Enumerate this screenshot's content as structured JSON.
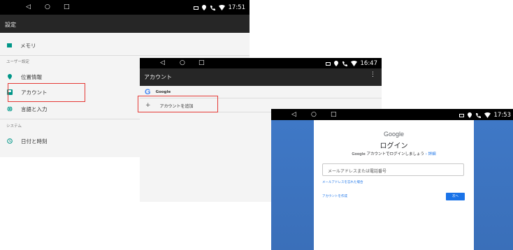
{
  "screen1": {
    "nav": {
      "back": "◁",
      "home": "○",
      "recent": "□"
    },
    "status": {
      "time": "17:51"
    },
    "title": "設定",
    "memory_label": "メモリ",
    "section_user": "ユーザー設定",
    "items": [
      {
        "label": "位置情報",
        "icon": "location-pin-icon"
      },
      {
        "label": "アカウント",
        "icon": "account-icon"
      },
      {
        "label": "言語と入力",
        "icon": "globe-icon"
      }
    ],
    "section_system": "システム",
    "date_time_label": "日付と時刻"
  },
  "screen2": {
    "nav": {
      "back": "◁",
      "home": "○",
      "recent": "□"
    },
    "status": {
      "time": "16:47"
    },
    "title": "アカウント",
    "overflow": "⋮",
    "google_label": "Google",
    "add_plus": "+",
    "add_account_label": "アカウントを追加"
  },
  "screen3": {
    "nav": {
      "back": "◁",
      "home": "○",
      "recent": "□"
    },
    "status": {
      "time": "17:53"
    },
    "brand": "Google",
    "heading": "ログイン",
    "subtitle": "Google アカウントでログインしましょう",
    "details_link": "詳細",
    "email_placeholder": "メールアドレスまたは電話番号",
    "forgot_email": "メールアドレスを忘れた場合",
    "create_account": "アカウントを作成",
    "next_button": "次へ"
  },
  "colors": {
    "highlight_box": "#e53935",
    "accent_blue": "#1a73e8",
    "icon_green": "#009688",
    "login_bg": "#3d75c2"
  }
}
